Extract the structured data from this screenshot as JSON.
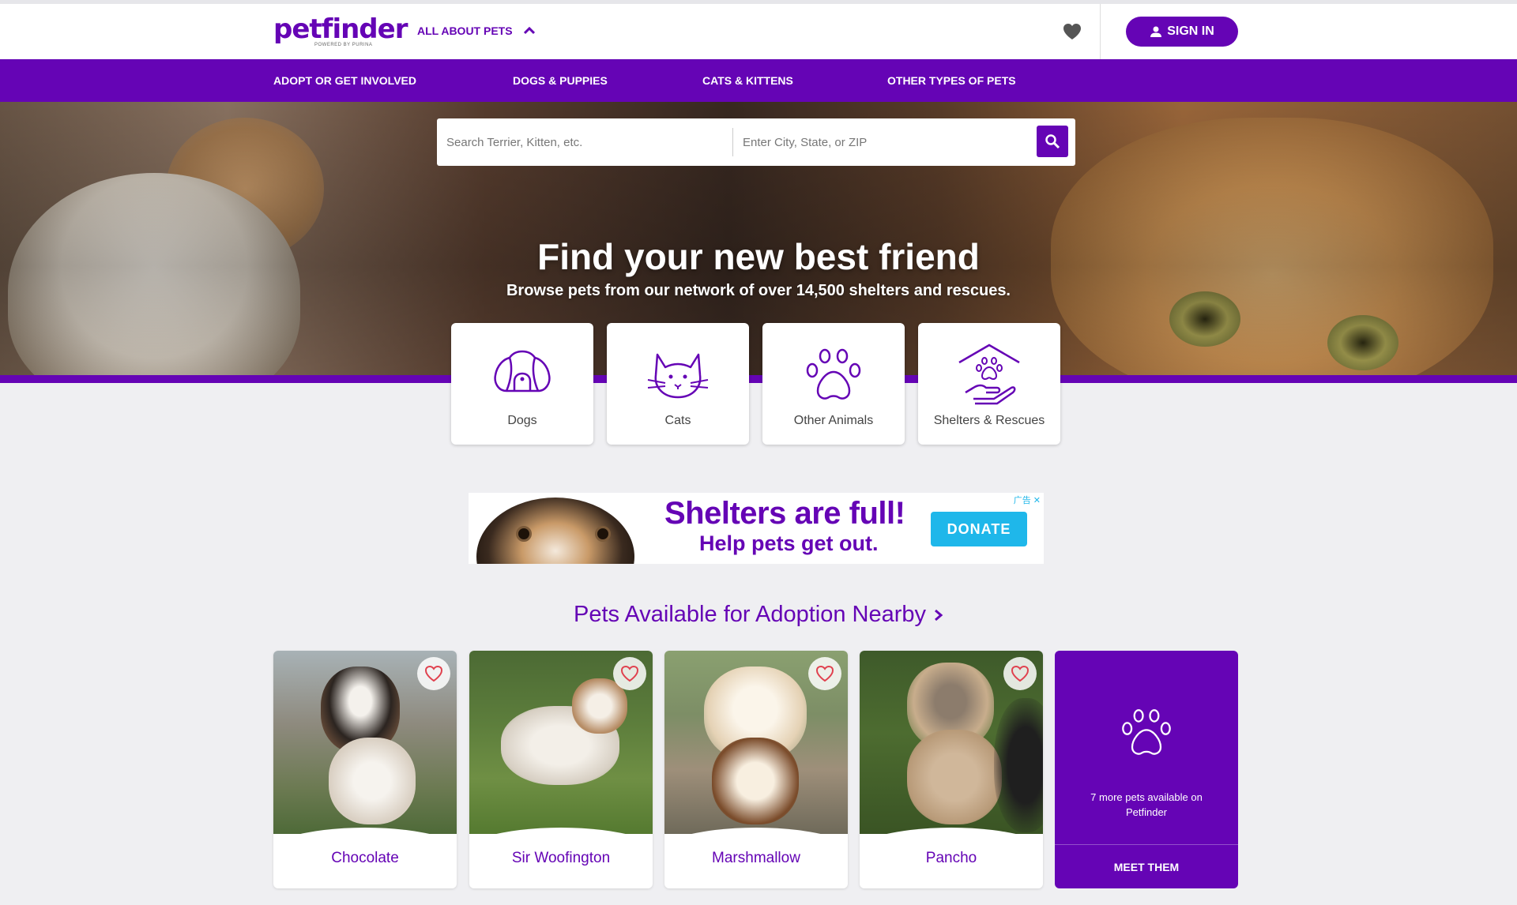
{
  "brand": {
    "logo_text": "petfinder",
    "logo_sub": "POWERED BY PURINA",
    "accent_color": "#6504b5",
    "heart_color": "#e0414e"
  },
  "header": {
    "about_label": "ALL ABOUT PETS",
    "favorites_icon": "heart-icon",
    "signin_label": "SIGN IN"
  },
  "nav": {
    "items": [
      {
        "label": "ADOPT OR GET INVOLVED"
      },
      {
        "label": "DOGS & PUPPIES"
      },
      {
        "label": "CATS & KITTENS"
      },
      {
        "label": "OTHER TYPES OF PETS"
      }
    ]
  },
  "search": {
    "pet_placeholder": "Search Terrier, Kitten, etc.",
    "location_placeholder": "Enter City, State, or ZIP",
    "button_icon": "search-icon"
  },
  "hero": {
    "title": "Find your new best friend",
    "subtitle": "Browse pets from our network of over 14,500 shelters and rescues."
  },
  "categories": [
    {
      "label": "Dogs",
      "icon": "dog-icon"
    },
    {
      "label": "Cats",
      "icon": "cat-icon"
    },
    {
      "label": "Other Animals",
      "icon": "paw-icon"
    },
    {
      "label": "Shelters & Rescues",
      "icon": "shelter-icon"
    }
  ],
  "ad": {
    "headline": "Shelters are full!",
    "subline": "Help pets get out.",
    "button_label": "DONATE",
    "ad_mark": "广告 ✕"
  },
  "pets_section": {
    "title": "Pets Available for Adoption Nearby",
    "pets": [
      {
        "name": "Chocolate"
      },
      {
        "name": "Sir Woofington"
      },
      {
        "name": "Marshmallow"
      },
      {
        "name": "Pancho"
      }
    ],
    "more_text": "7 more pets available on Petfinder",
    "more_button": "MEET THEM"
  }
}
